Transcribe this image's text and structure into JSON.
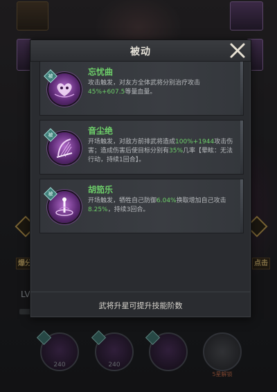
{
  "dialog": {
    "title": "被动",
    "footer_hint": "武将升星可提升技能阶数"
  },
  "skills": [
    {
      "name": "忘忧曲",
      "tag": "被",
      "icon": "heart-mask-icon",
      "desc_parts": [
        "攻击触发，对友方全体武将分别治疗攻击",
        "45%+607.5",
        "等量血量。"
      ]
    },
    {
      "name": "音尘绝",
      "tag": "被",
      "icon": "harp-strings-icon",
      "desc_parts": [
        "开场触发，对敌方前排武将造成",
        "100%+1944",
        "攻击伤害；造成伤害后使目标分别有",
        "35%",
        "几率【晕眩：无法行动，持续1回合】。"
      ]
    },
    {
      "name": "胡笳乐",
      "tag": "被",
      "icon": "flute-glow-icon",
      "desc_parts": [
        "开场触发，牺牲自己防御",
        "6.04%",
        "换取增加自己攻击",
        "8.25%",
        "，持续3回合。"
      ]
    }
  ],
  "background": {
    "level_label": "LV",
    "side_left": "爆分",
    "side_right": "点击",
    "skill_tiles": [
      {
        "level": "240",
        "tag": "被"
      },
      {
        "level": "240",
        "tag": "被"
      },
      {
        "level": "",
        "tag": "被"
      },
      {
        "level": "",
        "tag": "",
        "lock_text": "5星解锁"
      }
    ]
  },
  "colors": {
    "highlight_green": "#6ed06a",
    "dialog_bg": "#2a2c30",
    "skill_purple": "#b069c9"
  }
}
